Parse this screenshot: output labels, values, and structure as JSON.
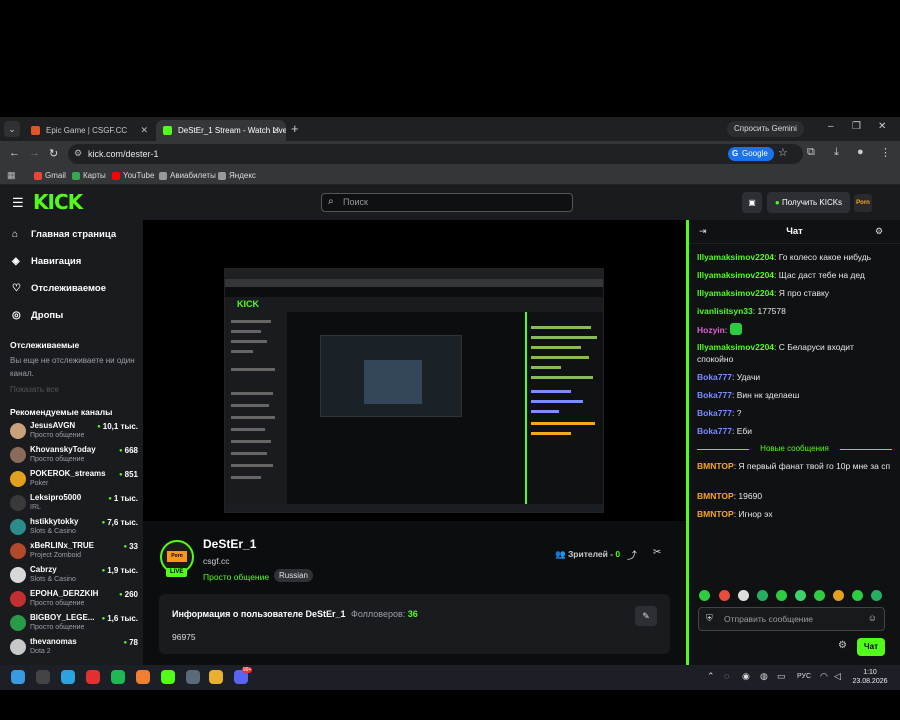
{
  "browser": {
    "tabs": [
      {
        "title": "Epic Game | CSGF.CC",
        "active": false
      },
      {
        "title": "DeStEr_1 Stream - Watch Live o",
        "active": true
      }
    ],
    "gemini_label": "Спросить Gemini",
    "url": "kick.com/dester-1",
    "search_engine_badge": "Google",
    "bookmarks": [
      "Gmail",
      "Карты",
      "YouTube",
      "Авиабилеты",
      "Яндекс"
    ]
  },
  "header": {
    "logo": "KICK",
    "search_placeholder": "Поиск",
    "get_kicks_label": "Получить KICKs"
  },
  "sidebar": {
    "nav": [
      {
        "label": "Главная страница",
        "icon": "home-icon"
      },
      {
        "label": "Навигация",
        "icon": "compass-icon"
      },
      {
        "label": "Отслеживаемое",
        "icon": "heart-icon"
      },
      {
        "label": "Дропы",
        "icon": "drops-icon"
      }
    ],
    "following_title": "Отслеживаемые",
    "following_empty": "Вы еще не отслеживаете ни один канал.",
    "following_hint": "Показать все",
    "recommended_title": "Рекомендуемые каналы",
    "channels": [
      {
        "name": "JesusAVGN",
        "category": "Просто общение",
        "viewers": "10,1 тыс.",
        "color": "#c9a27a"
      },
      {
        "name": "KhovanskyToday",
        "category": "Просто общение",
        "viewers": "668",
        "color": "#8a6a5a"
      },
      {
        "name": "POKEROK_streams",
        "category": "Poker",
        "viewers": "851",
        "color": "#e0a020"
      },
      {
        "name": "Leksipro5000",
        "category": "IRL",
        "viewers": "1 тыс.",
        "color": "#3a3a3a"
      },
      {
        "name": "hstikkytokky",
        "category": "Slots & Casino",
        "viewers": "7,6 тыс.",
        "color": "#2c8c8c"
      },
      {
        "name": "xBeRLINx_TRUE",
        "category": "Project Zomboid",
        "viewers": "33",
        "color": "#b04a2a"
      },
      {
        "name": "Cabrzy",
        "category": "Slots & Casino",
        "viewers": "1,9 тыс.",
        "color": "#d8d8d8"
      },
      {
        "name": "EPOHA_DERZKIH",
        "category": "Просто общение",
        "viewers": "260",
        "color": "#c03030"
      },
      {
        "name": "BIGBOY_LEGE...",
        "category": "Просто общение",
        "viewers": "1,6 тыс.",
        "color": "#2a9a4a"
      },
      {
        "name": "thevanomas",
        "category": "Dota 2",
        "viewers": "78",
        "color": "#c8c8c8"
      }
    ]
  },
  "stream": {
    "streamer_name": "DeStEr_1",
    "streamer_site": "csgf.cc",
    "category": "Просто общение",
    "language_tag": "Russian",
    "live_label": "LIVE",
    "avatar_text": "Porn",
    "viewers_label": "Зрителей -",
    "viewers_count": "0",
    "info_title": "Информация о пользователе DeStEr_1",
    "followers_label": "Фолловеров:",
    "followers_count": "36",
    "bio_number": "96975"
  },
  "chat": {
    "title": "Чат",
    "new_messages_label": "Новые сообщения",
    "messages_before": [
      {
        "user": "lllyamaksimov2204",
        "text": "Го колесо какое нибудь",
        "color": "#53fc18"
      },
      {
        "user": "lllyamaksimov2204",
        "text": "Щас даст тебе на дед",
        "color": "#53fc18"
      },
      {
        "user": "lllyamaksimov2204",
        "text": "Я про ставку",
        "color": "#53fc18"
      },
      {
        "user": "ivanlisitsyn33",
        "text": "177578",
        "color": "#53fc18"
      },
      {
        "user": "Hozyin",
        "text": "",
        "color": "#e05fd0",
        "emote": true
      },
      {
        "user": "lllyamaksimov2204",
        "text": "С Беларуси входит спокойно",
        "color": "#53fc18"
      },
      {
        "user": "Boka777",
        "text": "Удачи",
        "color": "#7b8cff"
      },
      {
        "user": "Boka777",
        "text": "Вин нк зделаеш",
        "color": "#7b8cff"
      },
      {
        "user": "Boka777",
        "text": "?",
        "color": "#7b8cff"
      },
      {
        "user": "Boka777",
        "text": "Еби",
        "color": "#7b8cff"
      }
    ],
    "messages_after": [
      {
        "user": "BMNTOP",
        "text": "Я первый фанат твой го 10р мне за сп",
        "color": "#f5a623"
      },
      {
        "user": "BMNTOP",
        "text": "19690",
        "color": "#f5a623"
      },
      {
        "user": "BMNTOP",
        "text": "Игнор эх",
        "color": "#f5a623"
      }
    ],
    "input_placeholder": "Отправить сообщение",
    "send_label": "Чат"
  },
  "taskbar": {
    "language": "РУС",
    "time": "1:10",
    "date": "23.08.2026",
    "badge": "99+"
  }
}
